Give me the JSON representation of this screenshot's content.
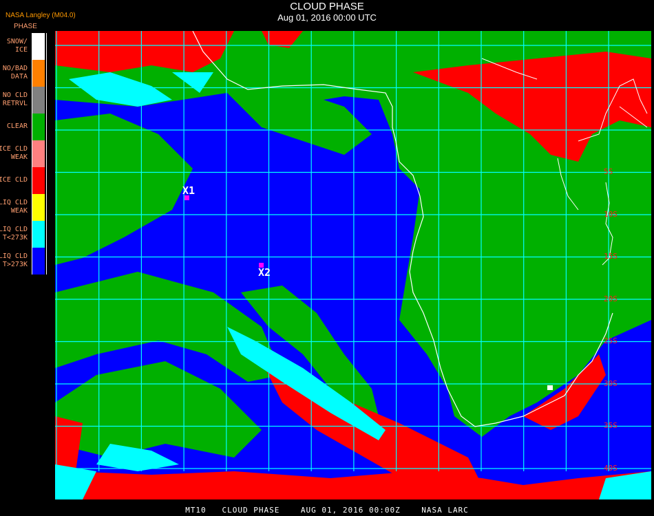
{
  "header": {
    "title": "CLOUD PHASE",
    "subtitle": "Aug 01, 2016 00:00 UTC",
    "source": "NASA Langley (M04.0)"
  },
  "legend": {
    "title": "PHASE",
    "items": [
      {
        "label": "SNOW/\nICE",
        "color": "#ffffff"
      },
      {
        "label": "NO/BAD\nDATA",
        "color": "#ff8000"
      },
      {
        "label": "NO CLD\nRETRVL",
        "color": "#808080"
      },
      {
        "label": "CLEAR",
        "color": "#00b000"
      },
      {
        "label": "ICE CLD\nWEAK",
        "color": "#ff8080"
      },
      {
        "label": "ICE CLD",
        "color": "#ff0000"
      },
      {
        "label": "LIQ CLD\nWEAK",
        "color": "#ffff00"
      },
      {
        "label": "LIQ CLD\nT<273K",
        "color": "#00ffff"
      },
      {
        "label": "LIQ CLD\nT>273K",
        "color": "#0000ff"
      }
    ]
  },
  "map": {
    "grid_color": "#00ffff",
    "coast_color": "#ffffff",
    "latitude_labels": [
      "5S",
      "10S",
      "15S",
      "20S",
      "25S",
      "30S",
      "35S",
      "40S"
    ],
    "markers": [
      {
        "label": "X1",
        "color": "#ff00ff"
      },
      {
        "label": "X2",
        "color": "#ff00ff"
      }
    ]
  },
  "footer": {
    "text": "MT10   CLOUD PHASE    AUG 01, 2016 00:00Z    NASA LARC"
  }
}
